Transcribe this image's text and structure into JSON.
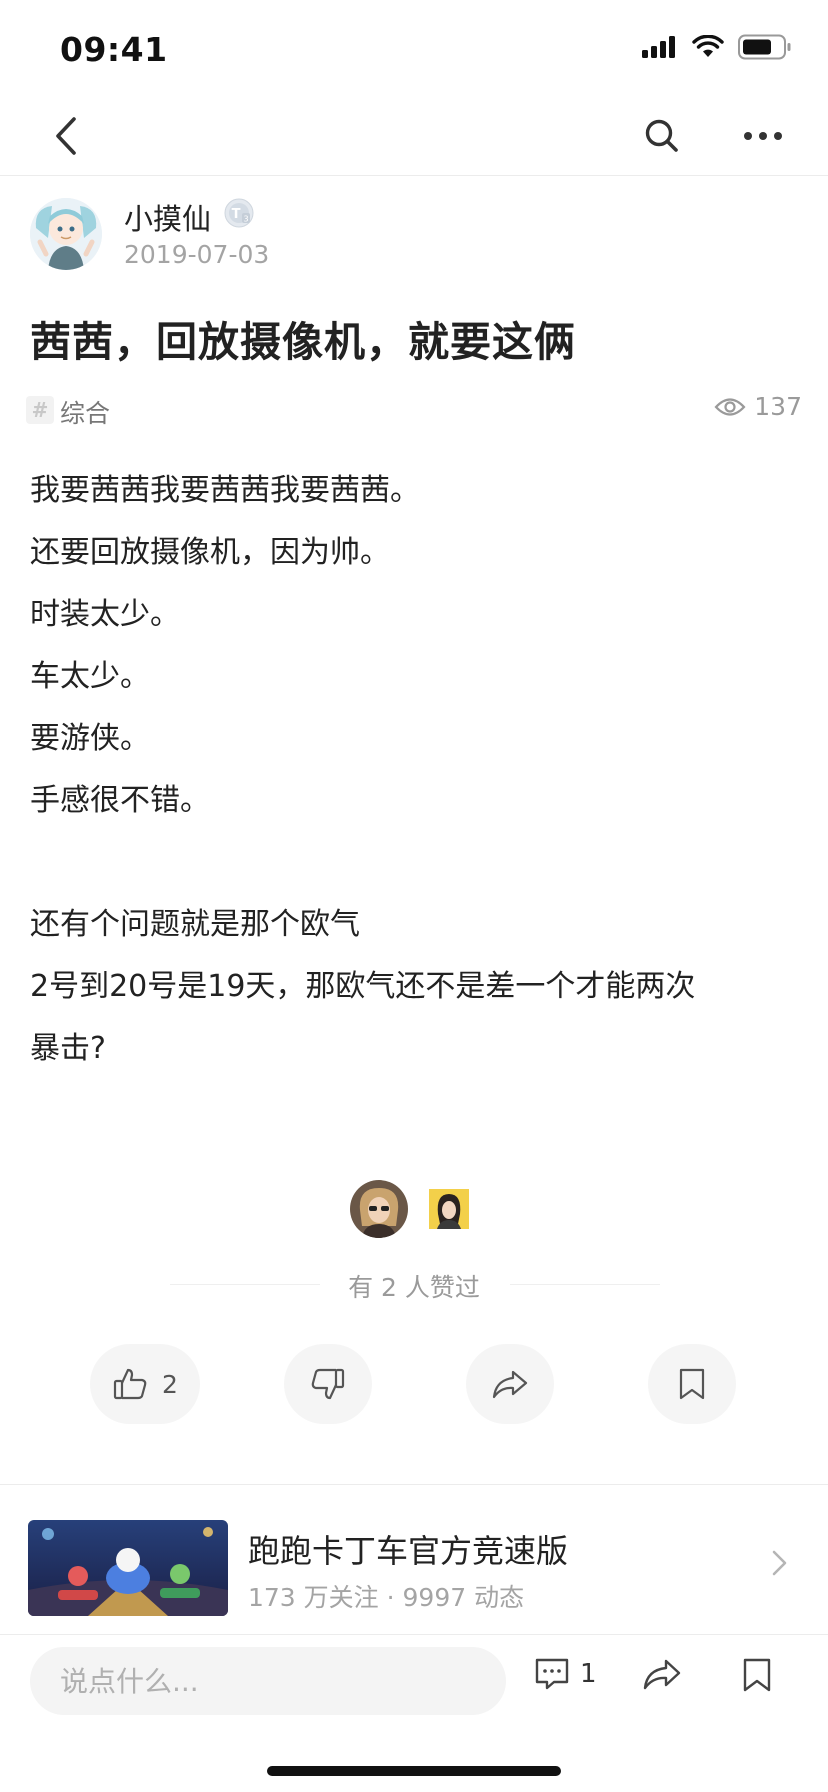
{
  "status_bar": {
    "time": "09:41"
  },
  "author": {
    "name": "小摸仙",
    "level_badge": "T3",
    "date": "2019-07-03"
  },
  "post": {
    "title": "茜茜，回放摄像机，就要这俩",
    "tag": "综合",
    "views": "137",
    "content_lines": [
      "我要茜茜我要茜茜我要茜茜。",
      "还要回放摄像机，因为帅。",
      "时装太少。",
      "车太少。",
      "要游侠。",
      "手感很不错。",
      "",
      "还有个问题就是那个欧气",
      "2号到20号是19天，那欧气还不是差一个才能两次",
      "暴击?"
    ]
  },
  "likes": {
    "summary": "有 2 人赞过",
    "like_count": "2"
  },
  "circle": {
    "name": "跑跑卡丁车官方竞速版",
    "meta": "173 万关注 · 9997 动态"
  },
  "bottom_bar": {
    "comment_placeholder": "说点什么...",
    "comment_count": "1"
  },
  "colors": {
    "accent_gray": "#f5f5f5",
    "text_primary": "#222222",
    "text_secondary": "#a4a4a4"
  },
  "icons": [
    "back-icon",
    "search-icon",
    "more-icon",
    "eye-icon",
    "thumb-up-icon",
    "thumb-down-icon",
    "share-icon",
    "bookmark-icon",
    "comment-icon",
    "chevron-right-icon"
  ]
}
